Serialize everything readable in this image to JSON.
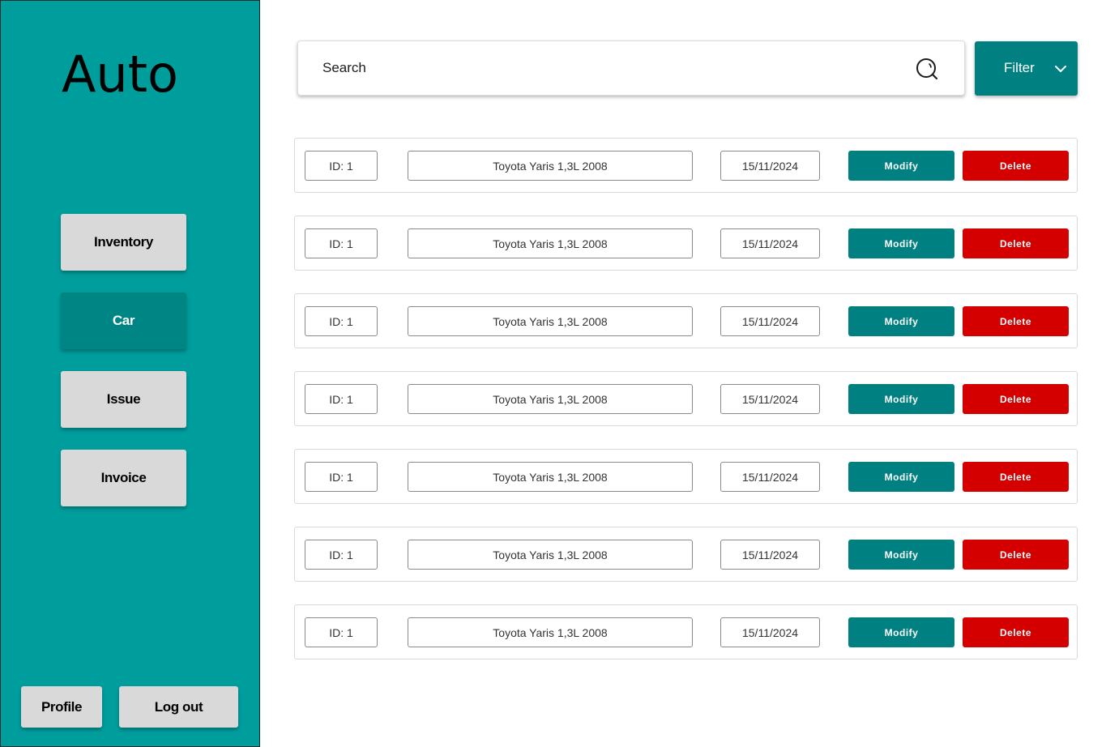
{
  "app": {
    "logo_text": "Auto"
  },
  "sidebar": {
    "nav": [
      {
        "label": "Inventory",
        "active": false
      },
      {
        "label": "Car",
        "active": true
      },
      {
        "label": "Issue",
        "active": false
      },
      {
        "label": "Invoice",
        "active": false
      }
    ],
    "profile_label": "Profile",
    "logout_label": "Log out"
  },
  "toolbar": {
    "search_placeholder": "Search",
    "filter_label": "Filter"
  },
  "colors": {
    "sidebar_bg": "#009d9d",
    "accent": "#008080",
    "danger": "#d40000",
    "nav_inactive": "#d9d9d9"
  },
  "rows": [
    {
      "id": "ID: 1",
      "name": "Toyota Yaris 1,3L 2008",
      "date": "15/11/2024",
      "modify": "Modify",
      "delete": "Delete"
    },
    {
      "id": "ID: 1",
      "name": "Toyota Yaris 1,3L 2008",
      "date": "15/11/2024",
      "modify": "Modify",
      "delete": "Delete"
    },
    {
      "id": "ID: 1",
      "name": "Toyota Yaris 1,3L 2008",
      "date": "15/11/2024",
      "modify": "Modify",
      "delete": "Delete"
    },
    {
      "id": "ID: 1",
      "name": "Toyota Yaris 1,3L 2008",
      "date": "15/11/2024",
      "modify": "Modify",
      "delete": "Delete"
    },
    {
      "id": "ID: 1",
      "name": "Toyota Yaris 1,3L 2008",
      "date": "15/11/2024",
      "modify": "Modify",
      "delete": "Delete"
    },
    {
      "id": "ID: 1",
      "name": "Toyota Yaris 1,3L 2008",
      "date": "15/11/2024",
      "modify": "Modify",
      "delete": "Delete"
    },
    {
      "id": "ID: 1",
      "name": "Toyota Yaris 1,3L 2008",
      "date": "15/11/2024",
      "modify": "Modify",
      "delete": "Delete"
    }
  ]
}
